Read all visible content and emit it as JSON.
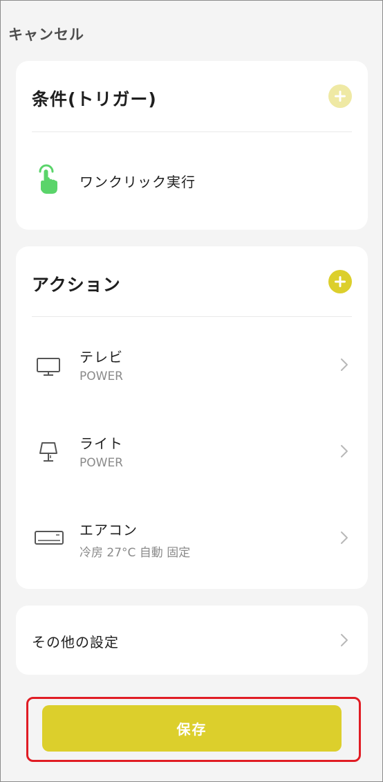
{
  "header": {
    "cancel_label": "キャンセル"
  },
  "trigger": {
    "title": "条件(トリガー)",
    "add_state": "disabled",
    "items": [
      {
        "label": "ワンクリック実行",
        "icon": "tap-hand-icon"
      }
    ]
  },
  "actions": {
    "title": "アクション",
    "items": [
      {
        "label": "テレビ",
        "detail": "POWER",
        "icon": "tv-icon"
      },
      {
        "label": "ライト",
        "detail": "POWER",
        "icon": "lamp-icon"
      },
      {
        "label": "エアコン",
        "detail": "冷房 27°C 自動 固定",
        "icon": "air-conditioner-icon"
      }
    ]
  },
  "other": {
    "label": "その他の設定"
  },
  "footer": {
    "save_label": "保存"
  },
  "colors": {
    "accent": "#dccf2c",
    "accent_disabled": "#efe9a4",
    "trigger_green": "#5ad46a",
    "highlight_red": "#e01c24"
  }
}
